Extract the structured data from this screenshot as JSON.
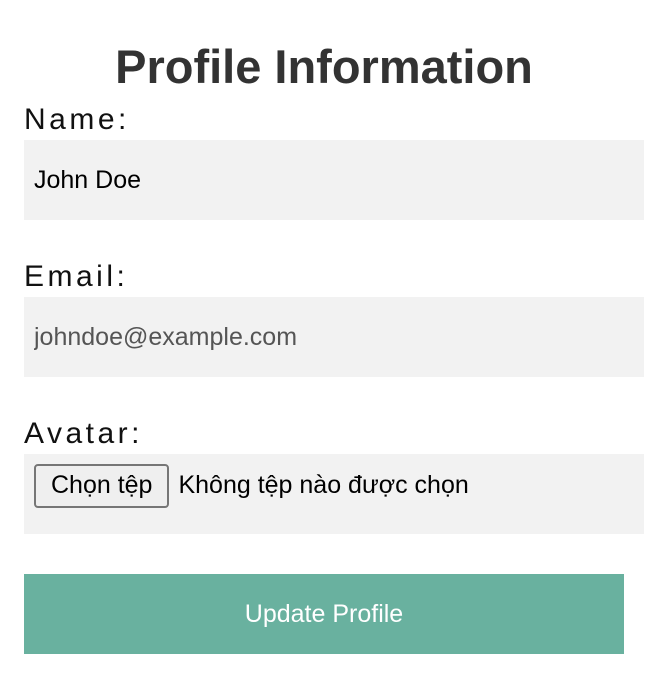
{
  "page": {
    "title": "Profile Information"
  },
  "form": {
    "name": {
      "label": "Name:",
      "value": "John Doe"
    },
    "email": {
      "label": "Email:",
      "value": "",
      "placeholder": "johndoe@example.com"
    },
    "avatar": {
      "label": "Avatar:",
      "button_label": "Chọn tệp",
      "status": "Không tệp nào được chọn"
    },
    "submit_label": "Update Profile"
  },
  "colors": {
    "field_background": "#f2f2f2",
    "submit_background": "#69b19f",
    "submit_text": "#ffffff",
    "title_text": "#333333"
  }
}
